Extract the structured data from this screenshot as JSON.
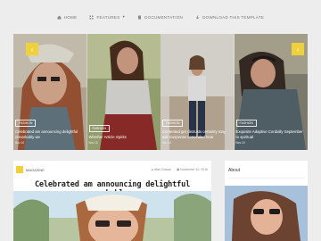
{
  "nav": {
    "items": [
      {
        "label": "Home",
        "icon": "home-icon"
      },
      {
        "label": "Features",
        "icon": "grid-icon",
        "dropdown": true
      },
      {
        "label": "Documentation",
        "icon": "book-icon"
      },
      {
        "label": "Download This Template",
        "icon": "download-icon"
      }
    ]
  },
  "slider": {
    "slides": [
      {
        "category": "Fashion",
        "title": "Celebrated am announcing delightful remarkably we",
        "date": "Nov 10"
      },
      {
        "category": "Fashion",
        "title": "Whether Article Spirits",
        "date": "Nov 10"
      },
      {
        "category": "Fashion",
        "title": "Contented get distrusts certainty may ask Suspense concealed hear",
        "date": "Nov 10"
      },
      {
        "category": "Fashion",
        "title": "Exquisite Adaptive Cordially September to spiritual",
        "date": "Nov 10"
      }
    ],
    "prev_icon": "chevron-left-icon",
    "next_icon": "chevron-right-icon",
    "accent": "#f1d13a"
  },
  "post": {
    "category_label": "Magazine",
    "author": "Irfan Gnwan",
    "date": "November 10, 2016",
    "title": "Celebrated am announcing delightful remarkably we"
  },
  "sidebar": {
    "about_title": "About"
  }
}
